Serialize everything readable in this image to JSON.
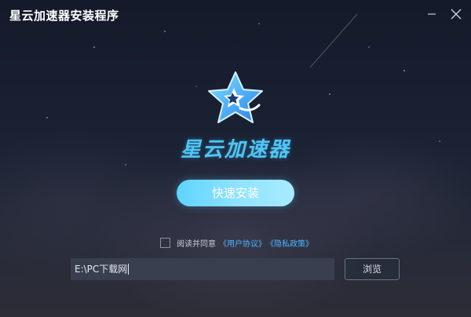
{
  "window": {
    "title": "星云加速器安装程序",
    "minimize_icon": "minimize-icon",
    "close_icon": "close-icon"
  },
  "logo": {
    "icon": "star-logo-icon",
    "brand_name": "星云加速器"
  },
  "install_button": {
    "label": "快速安装"
  },
  "agreement": {
    "checked": false,
    "text": "阅读并同意",
    "user_agreement_link": "《用户协议》",
    "privacy_policy_link": "《隐私政策》"
  },
  "install_path": {
    "value": "E:\\PC下载网"
  },
  "browse_button": {
    "label": "浏览"
  },
  "colors": {
    "accent": "#5ed4ff",
    "link": "#4db4ff",
    "background": "#1b2234"
  }
}
